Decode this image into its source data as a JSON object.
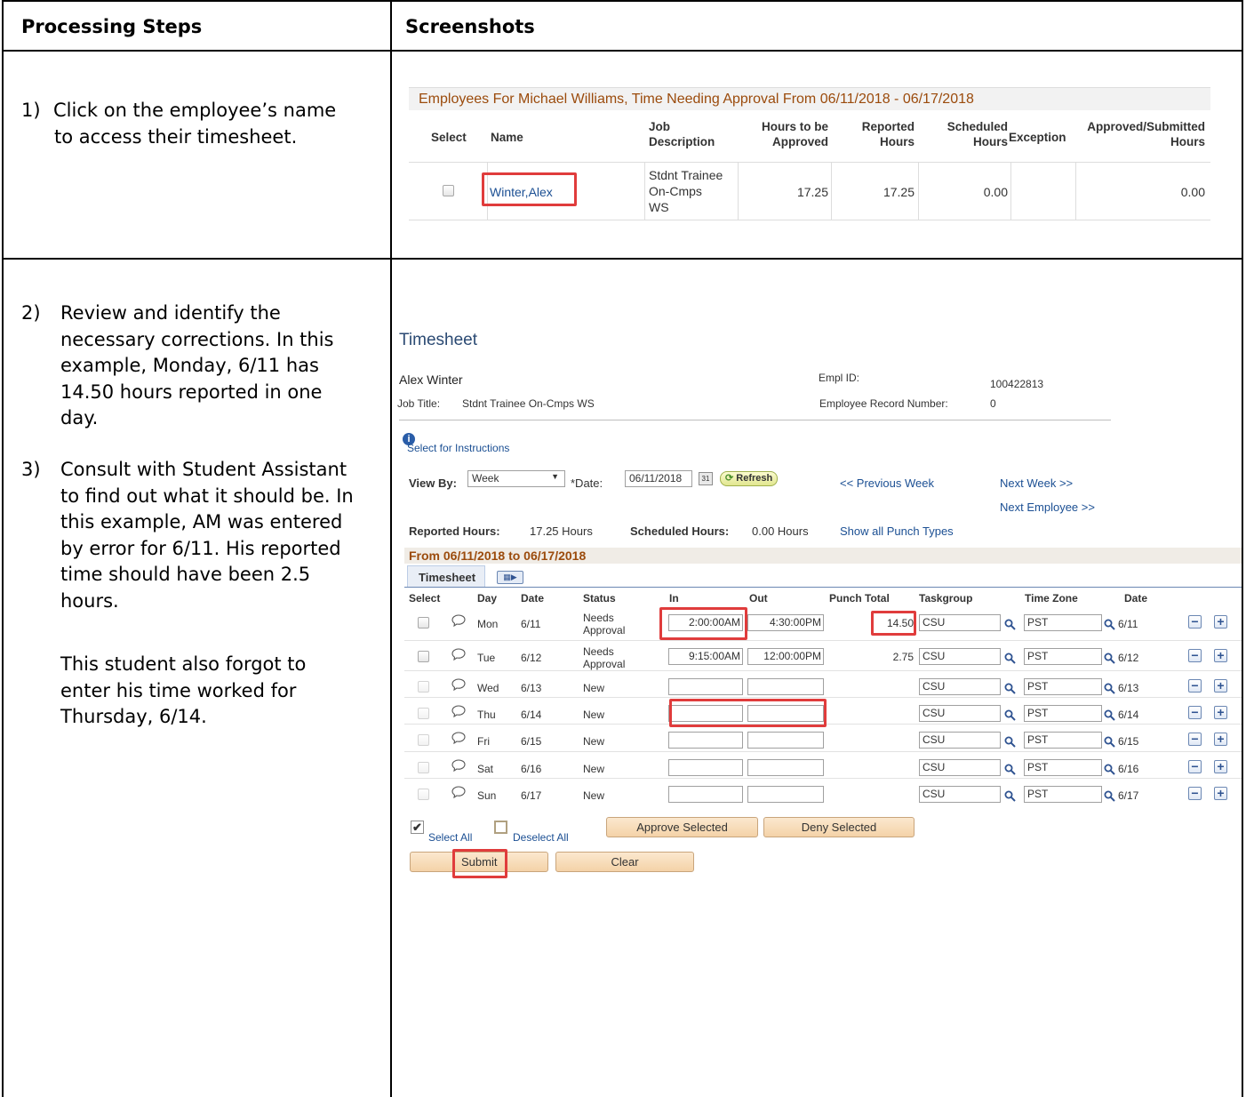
{
  "doc": {
    "col1_header": "Processing Steps",
    "col2_header": "Screenshots",
    "steps": [
      {
        "num": "1)",
        "text": "Click on the employee’s name to access their timesheet."
      },
      {
        "num": "2)",
        "text": "Review and identify the necessary corrections. In this example, Monday, 6/11 has 14.50 hours reported in one day."
      },
      {
        "num": "3)",
        "text": "Consult with Student Assistant to find out what it should be. In this example, AM was entered by error for 6/11. His reported time should have been 2.5 hours."
      },
      {
        "num": "",
        "text": "This student also forgot to enter his time worked for Thursday, 6/14."
      }
    ]
  },
  "approval": {
    "title": "Employees For Michael Williams, Time Needing Approval From 06/11/2018 - 06/17/2018",
    "headers": {
      "select": "Select",
      "name": "Name",
      "job1": "Job",
      "job2": "Description",
      "hrs1": "Hours to be",
      "hrs2": "Approved",
      "rep1": "Reported",
      "rep2": "Hours",
      "sch1": "Scheduled",
      "sch2": "Hours",
      "exception": "Exception",
      "app1": "Approved/Submitted",
      "app2": "Hours"
    },
    "row": {
      "name": "Winter,Alex",
      "job1": "Stdnt Trainee",
      "job2": "On-Cmps",
      "job3": "WS",
      "hours_to_approve": "17.25",
      "reported": "17.25",
      "scheduled": "0.00",
      "exception": "",
      "approved": "0.00"
    }
  },
  "timesheet": {
    "title": "Timesheet",
    "employee_name": "Alex Winter",
    "empl_id_label": "Empl ID:",
    "empl_id": "100422813",
    "job_title_label": "Job Title:",
    "job_title": "Stdnt Trainee On-Cmps WS",
    "record_label": "Employee Record Number:",
    "record": "0",
    "instructions": "Select for Instructions",
    "view_by_label": "View By:",
    "view_by": "Week",
    "date_label": "*Date:",
    "date": "06/11/2018",
    "refresh": "Refresh",
    "prev_week": "<< Previous Week",
    "next_week": "Next Week >>",
    "next_employee": "Next Employee >>",
    "reported_label": "Reported Hours:",
    "reported": "17.25 Hours",
    "scheduled_label": "Scheduled Hours:",
    "scheduled": "0.00 Hours",
    "punch_types": "Show all Punch Types",
    "period": "From 06/11/2018 to 06/17/2018",
    "tab": "Timesheet",
    "columns": {
      "select": "Select",
      "day": "Day",
      "date": "Date",
      "status": "Status",
      "in": "In",
      "out": "Out",
      "punch_total": "Punch Total",
      "taskgroup": "Taskgroup",
      "time_zone": "Time Zone",
      "date2": "Date"
    },
    "rows": [
      {
        "day": "Mon",
        "date": "6/11",
        "status1": "Needs",
        "status2": "Approval",
        "in": "2:00:00AM",
        "out": "4:30:00PM",
        "total": "14.50",
        "taskgroup": "CSU",
        "tz": "PST",
        "date2": "6/11"
      },
      {
        "day": "Tue",
        "date": "6/12",
        "status1": "Needs",
        "status2": "Approval",
        "in": "9:15:00AM",
        "out": "12:00:00PM",
        "total": "2.75",
        "taskgroup": "CSU",
        "tz": "PST",
        "date2": "6/12"
      },
      {
        "day": "Wed",
        "date": "6/13",
        "status1": "New",
        "status2": "",
        "in": "",
        "out": "",
        "total": "",
        "taskgroup": "CSU",
        "tz": "PST",
        "date2": "6/13"
      },
      {
        "day": "Thu",
        "date": "6/14",
        "status1": "New",
        "status2": "",
        "in": "",
        "out": "",
        "total": "",
        "taskgroup": "CSU",
        "tz": "PST",
        "date2": "6/14"
      },
      {
        "day": "Fri",
        "date": "6/15",
        "status1": "New",
        "status2": "",
        "in": "",
        "out": "",
        "total": "",
        "taskgroup": "CSU",
        "tz": "PST",
        "date2": "6/15"
      },
      {
        "day": "Sat",
        "date": "6/16",
        "status1": "New",
        "status2": "",
        "in": "",
        "out": "",
        "total": "",
        "taskgroup": "CSU",
        "tz": "PST",
        "date2": "6/16"
      },
      {
        "day": "Sun",
        "date": "6/17",
        "status1": "New",
        "status2": "",
        "in": "",
        "out": "",
        "total": "",
        "taskgroup": "CSU",
        "tz": "PST",
        "date2": "6/17"
      }
    ],
    "select_all": "Select All",
    "deselect_all": "Deselect All",
    "approve_selected": "Approve Selected",
    "deny_selected": "Deny Selected",
    "submit": "Submit",
    "clear": "Clear"
  }
}
